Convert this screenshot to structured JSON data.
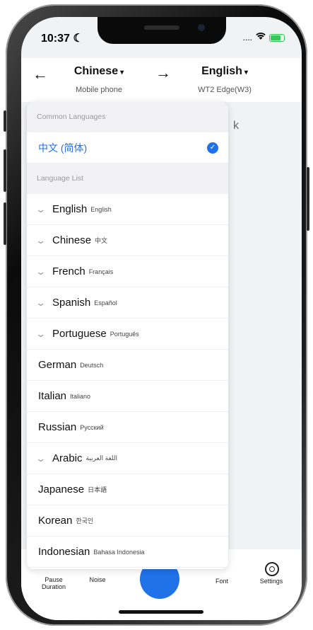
{
  "status_bar": {
    "time": "10:37",
    "signal": "....",
    "wifi": "wifi"
  },
  "header": {
    "source_lang": "Chinese",
    "source_device": "Mobile phone",
    "target_lang": "English",
    "target_device": "WT2 Edge(W3)",
    "caret": "▾",
    "back_icon": "←",
    "arrow_icon": "→"
  },
  "background_text": "k",
  "dropdown": {
    "common_label": "Common Languages",
    "common_items": [
      {
        "label": "中文 (简体)",
        "selected": true
      }
    ],
    "list_label": "Language List",
    "items": [
      {
        "name": "English",
        "native": "English",
        "expandable": true
      },
      {
        "name": "Chinese",
        "native": "中文",
        "expandable": true
      },
      {
        "name": "French",
        "native": "Français",
        "expandable": true
      },
      {
        "name": "Spanish",
        "native": "Español",
        "expandable": true
      },
      {
        "name": "Portuguese",
        "native": "Português",
        "expandable": true
      },
      {
        "name": "German",
        "native": "Deutsch",
        "expandable": false
      },
      {
        "name": "Italian",
        "native": "Italiano",
        "expandable": false
      },
      {
        "name": "Russian",
        "native": "Русский",
        "expandable": false
      },
      {
        "name": "Arabic",
        "native": "اللغة العربية",
        "expandable": true
      },
      {
        "name": "Japanese",
        "native": "日本語",
        "expandable": false
      },
      {
        "name": "Korean",
        "native": "한국인",
        "expandable": false
      },
      {
        "name": "Indonesian",
        "native": "Bahasa Indonesia",
        "expandable": false
      }
    ]
  },
  "bottom_bar": {
    "pause": "Pause Duration",
    "noise": "Noise",
    "font": "Font",
    "settings": "Settings"
  },
  "colors": {
    "accent": "#1f72e8",
    "battery": "#34c759"
  }
}
